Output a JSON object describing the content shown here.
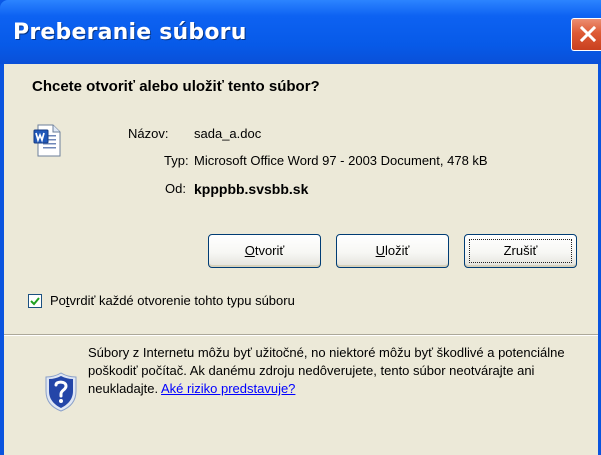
{
  "window": {
    "title": "Preberanie súboru"
  },
  "dialog": {
    "question": "Chcete otvoriť alebo uložiť tento súbor?",
    "file": {
      "name_label": "Názov:",
      "name_value": "sada_a.doc",
      "type_label": "Typ:",
      "type_value": "Microsoft Office Word 97 - 2003 Document, 478 kB",
      "from_label": "Od:",
      "from_value": "kpppbb.svsbb.sk",
      "icon": "word-document-icon"
    },
    "buttons": {
      "open_first": "O",
      "open_rest": "tvoriť",
      "save_first": "U",
      "save_rest": "ložiť",
      "cancel": "Zrušiť"
    },
    "checkbox": {
      "checked": true,
      "label_before": "Po",
      "label_mnemonic": "t",
      "label_after": "vrdiť každé otvorenie tohto typu súboru"
    },
    "warning": {
      "text": "Súbory z Internetu môžu byť užitočné, no niektoré môžu byť škodlivé a potenciálne poškodiť počítač. Ak danému zdroju nedôverujete, tento súbor neotvárajte ani neukladajte. ",
      "link": "Aké riziko predstavuje?",
      "icon": "shield-question-icon"
    }
  },
  "colors": {
    "titlebar": "#075ae8",
    "dialog_background": "#ece9d8",
    "close_button": "#de5a35",
    "link": "#0000ff"
  }
}
